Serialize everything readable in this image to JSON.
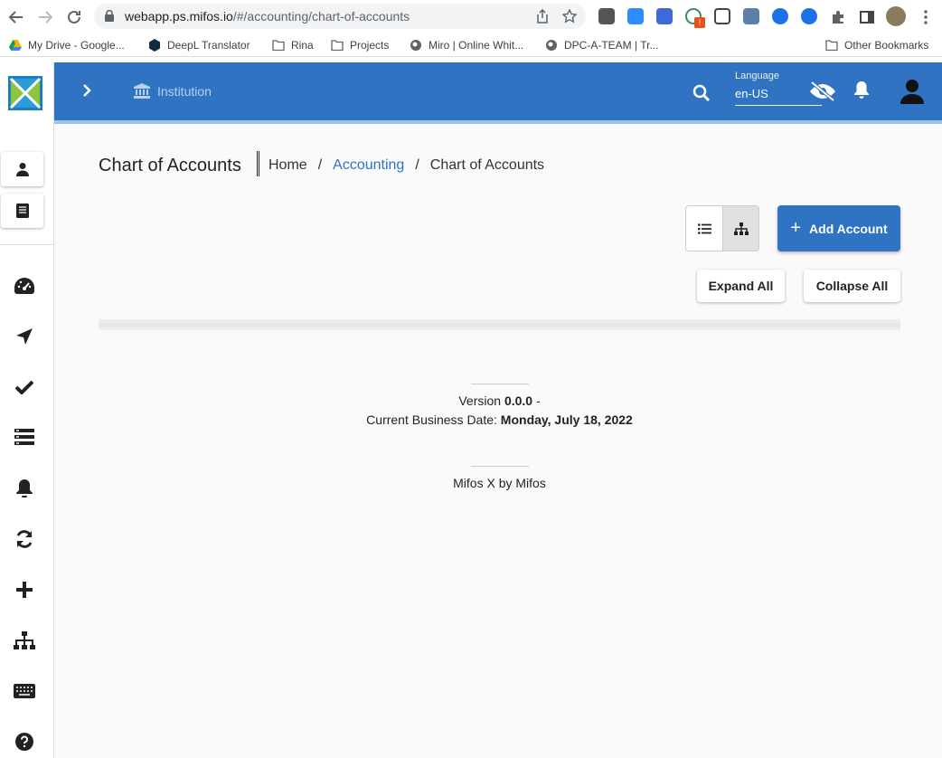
{
  "browser": {
    "url_host": "webapp.ps.mifos.io",
    "url_path": "/#/accounting/chart-of-accounts",
    "bookmarks": [
      "My Drive - Google...",
      "DeepL Translator",
      "Rina",
      "Projects",
      "Miro | Online Whit...",
      "DPC-A-TEAM | Tr..."
    ],
    "other_bookmarks": "Other Bookmarks",
    "extension_badge": "!"
  },
  "topbar": {
    "institution": "Institution",
    "language_label": "Language",
    "language_value": "en-US"
  },
  "page": {
    "title": "Chart of Accounts",
    "breadcrumb": [
      "Home",
      "Accounting",
      "Chart of Accounts"
    ],
    "breadcrumb_sep": "/",
    "add_account": "Add Account",
    "expand_all": "Expand All",
    "collapse_all": "Collapse All"
  },
  "footer": {
    "version_label": "Version ",
    "version": "0.0.0",
    "version_suffix": " -",
    "business_date_label": "Current Business Date: ",
    "business_date": "Monday, July 18, 2022",
    "credit": "Mifos X by Mifos"
  },
  "colors": {
    "primary": "#2f73c2",
    "accent_line": "#9ec3ea",
    "background": "#fafafa"
  }
}
